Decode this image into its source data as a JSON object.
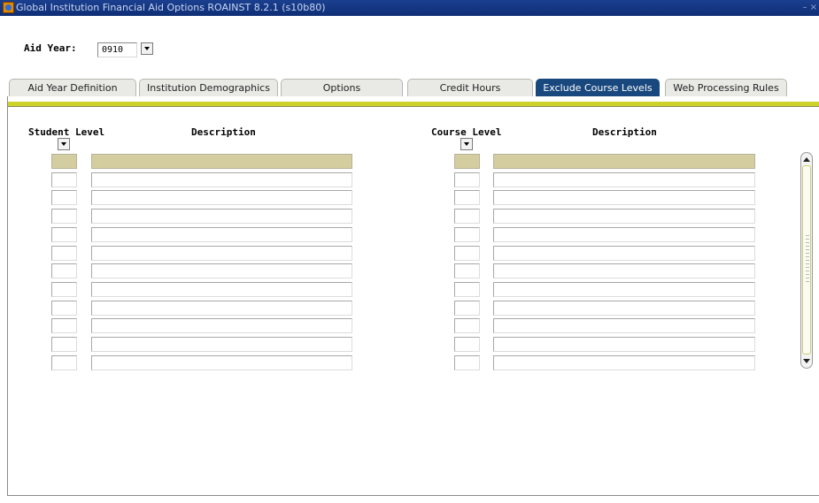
{
  "window": {
    "title": "Global Institution Financial Aid Options  ROAINST  8.2.1  (s10b80)",
    "controls": "– ×"
  },
  "key_block": {
    "aid_year_label": "Aid Year:",
    "aid_year_value": "0910"
  },
  "tabs": [
    {
      "label": "Aid Year Definition",
      "active": false
    },
    {
      "label": "Institution Demographics",
      "active": false
    },
    {
      "label": "Options",
      "active": false
    },
    {
      "label": "Credit Hours",
      "active": false
    },
    {
      "label": "Exclude Course Levels",
      "active": true
    },
    {
      "label": "Web Processing Rules",
      "active": false
    }
  ],
  "student_levels": {
    "level_header": "Student Level",
    "description_header": "Description",
    "rows": [
      {
        "level": "",
        "description": ""
      },
      {
        "level": "",
        "description": ""
      },
      {
        "level": "",
        "description": ""
      },
      {
        "level": "",
        "description": ""
      },
      {
        "level": "",
        "description": ""
      },
      {
        "level": "",
        "description": ""
      },
      {
        "level": "",
        "description": ""
      },
      {
        "level": "",
        "description": ""
      },
      {
        "level": "",
        "description": ""
      },
      {
        "level": "",
        "description": ""
      },
      {
        "level": "",
        "description": ""
      },
      {
        "level": "",
        "description": ""
      }
    ]
  },
  "course_levels": {
    "level_header": "Course Level",
    "description_header": "Description",
    "rows": [
      {
        "level": "",
        "description": ""
      },
      {
        "level": "",
        "description": ""
      },
      {
        "level": "",
        "description": ""
      },
      {
        "level": "",
        "description": ""
      },
      {
        "level": "",
        "description": ""
      },
      {
        "level": "",
        "description": ""
      },
      {
        "level": "",
        "description": ""
      },
      {
        "level": "",
        "description": ""
      },
      {
        "level": "",
        "description": ""
      },
      {
        "level": "",
        "description": ""
      },
      {
        "level": "",
        "description": ""
      },
      {
        "level": "",
        "description": ""
      }
    ]
  },
  "colors": {
    "title_bar": "#1b3f8f",
    "active_tab": "#18487d",
    "separator_band": "#cdd22a",
    "current_record": "#d3cda0"
  }
}
